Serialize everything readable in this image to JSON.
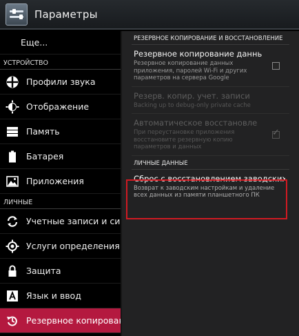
{
  "actionbar": {
    "title": "Параметры",
    "icon": "settings-app-icon"
  },
  "sidebar": {
    "more_label": "Еще...",
    "header_device": "УСТРОЙСТВО",
    "header_personal": "ЛИЧНЫЕ",
    "items": [
      {
        "label": "Профили звука",
        "icon": "sound-profile-icon"
      },
      {
        "label": "Отображение",
        "icon": "display-icon"
      },
      {
        "label": "Память",
        "icon": "storage-icon"
      },
      {
        "label": "Батарея",
        "icon": "battery-icon"
      },
      {
        "label": "Приложения",
        "icon": "apps-icon"
      },
      {
        "label": "Учетные записи и синхр",
        "icon": "sync-icon"
      },
      {
        "label": "Услуги определения ме",
        "icon": "location-icon"
      },
      {
        "label": "Защита",
        "icon": "lock-icon"
      },
      {
        "label": "Язык и ввод",
        "icon": "language-icon"
      },
      {
        "label": "Резервное копировани",
        "icon": "backup-icon"
      }
    ],
    "selected_color": "#b4193f"
  },
  "content": {
    "section_backup": "РЕЗЕРВНОЕ КОПИРОВАНИЕ И ВОССТАНОВЛЕНИЕ",
    "section_personal": "ЛИЧНЫЕ ДАННЫЕ",
    "prefs": [
      {
        "title": "Резервное копирование данны",
        "summary": "Резервное копирование данных приложения, паролей Wi-Fi и других параметров на сервера Google",
        "checked": false
      },
      {
        "title": "Резерв. копир. учет. записи",
        "summary": "Backing up to debug-only private cache"
      },
      {
        "title": "Автоматическое восстановле",
        "summary": "При переустановке приложения восстановите резервную копию параметров и данных",
        "checked": true
      }
    ],
    "reset": {
      "title": "Сброс с восстановлением заводских н",
      "summary": "Возврат к заводским настройкам и удаление всех данных из памяти планшетного ПК"
    },
    "highlight_color": "#d21a22"
  }
}
